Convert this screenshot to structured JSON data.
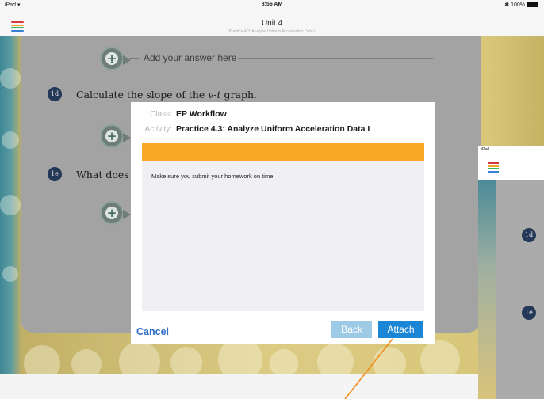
{
  "status_bar": {
    "device": "iPad",
    "time": "8:56 AM",
    "battery": "100%"
  },
  "header": {
    "title": "Unit 4",
    "subtitle": "Practice 4.3: Analyze Uniform Acceleration Data I"
  },
  "menu_icon_colors": [
    "#d83a3a",
    "#f2a22b",
    "#3bb25b",
    "#3b7fd6"
  ],
  "worksheet": {
    "add_answer_label": "Add your answer here",
    "questions": [
      {
        "badge": "1d",
        "text_before": "Calculate the slope of the ",
        "text_var": "v-t",
        "text_after": " graph."
      },
      {
        "badge": "1e",
        "text_before": "What does",
        "text_var": "",
        "text_after": ""
      }
    ]
  },
  "dialog": {
    "class_label": "Class:",
    "class_value": "EP Workflow",
    "activity_label": "Activity:",
    "activity_value": "Practice 4.3: Analyze Uniform Acceleration Data I",
    "message": "Make sure you submit your homework on time.",
    "cancel_label": "Cancel",
    "back_label": "Back",
    "attach_label": "Attach",
    "accent_color": "#f7a827",
    "primary_color": "#1c86d6"
  },
  "peek_panel": {
    "device": "iPad",
    "badges": [
      "1d",
      "1e"
    ]
  }
}
